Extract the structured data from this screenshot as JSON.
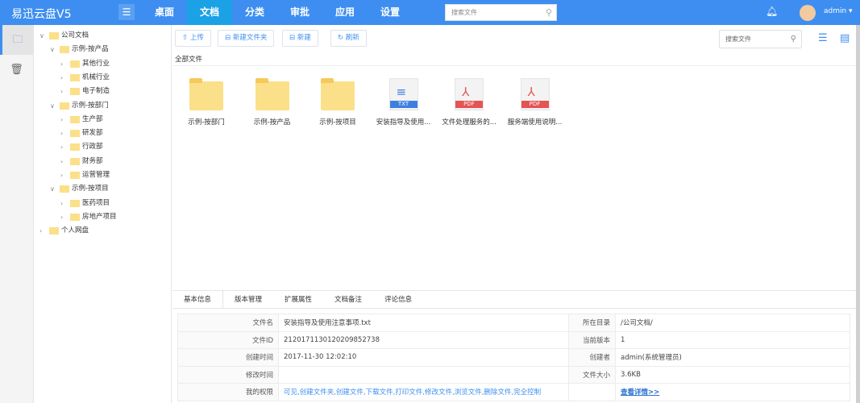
{
  "header": {
    "logo": "易迅云盘V5",
    "nav": [
      "桌面",
      "文档",
      "分类",
      "审批",
      "应用",
      "设置"
    ],
    "active_nav": "文档",
    "search_placeholder": "搜索文件",
    "user": "admin ▾"
  },
  "tree": [
    {
      "label": "公司文档",
      "level": 0,
      "open": true
    },
    {
      "label": "示例-按产品",
      "level": 1,
      "open": true
    },
    {
      "label": "其他行业",
      "level": 2
    },
    {
      "label": "机械行业",
      "level": 2
    },
    {
      "label": "电子制造",
      "level": 2
    },
    {
      "label": "示例-按部门",
      "level": 1,
      "open": true
    },
    {
      "label": "生产部",
      "level": 2
    },
    {
      "label": "研发部",
      "level": 2
    },
    {
      "label": "行政部",
      "level": 2
    },
    {
      "label": "财务部",
      "level": 2
    },
    {
      "label": "运营管理",
      "level": 2
    },
    {
      "label": "示例-按项目",
      "level": 1,
      "open": true
    },
    {
      "label": "医药项目",
      "level": 2
    },
    {
      "label": "房地产项目",
      "level": 2
    },
    {
      "label": "个人网盘",
      "level": 0
    }
  ],
  "toolbar": {
    "upload": "上传",
    "new_folder": "新建文件夹",
    "new": "新建",
    "refresh": "刷新",
    "search_placeholder": "搜索文件"
  },
  "breadcrumb": "全部文件",
  "files": [
    {
      "name": "示例-按部门",
      "type": "folder"
    },
    {
      "name": "示例-按产品",
      "type": "folder"
    },
    {
      "name": "示例-按项目",
      "type": "folder"
    },
    {
      "name": "安装指导及使用...",
      "type": "TXT"
    },
    {
      "name": "文件处理服务的...",
      "type": "PDF"
    },
    {
      "name": "服务端使用说明...",
      "type": "PDF"
    }
  ],
  "tabs": [
    "基本信息",
    "版本管理",
    "扩展属性",
    "文档备注",
    "评论信息"
  ],
  "info": {
    "rows": [
      [
        "文件名",
        "安装指导及使用注意事项.txt",
        "所在目录",
        "/公司文档/"
      ],
      [
        "文件ID",
        "2120171130120209852738",
        "当前版本",
        "1"
      ],
      [
        "创建时间",
        "2017-11-30 12:02:10",
        "创建者",
        "admin(系统管理员)"
      ],
      [
        "修改时间",
        "",
        "文件大小",
        "3.6KB"
      ]
    ],
    "perm_label": "我的权限",
    "perm_value": "可见,创建文件夹,创建文件,下载文件,打印文件,修改文件,浏览文件,删除文件,完全控制",
    "details_link": "查看详情>>"
  },
  "colors": {
    "header": "#3d8ef0",
    "active_nav": "#1ba1e6",
    "folder": "#fbe08a",
    "txt": "#3d7fe0",
    "pdf": "#e55353"
  }
}
